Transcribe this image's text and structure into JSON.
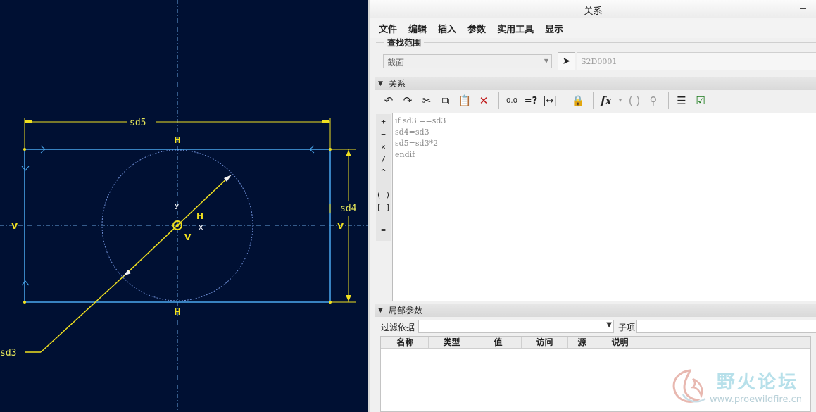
{
  "sketch": {
    "dimensions": [
      "sd5",
      "sd4",
      "sd3"
    ],
    "constraints": {
      "horizontal": "H",
      "vertical": "V"
    },
    "axis_labels": {
      "x": "x",
      "y": "y"
    }
  },
  "dialog": {
    "title": "关系",
    "menu": [
      "文件",
      "编辑",
      "插入",
      "参数",
      "实用工具",
      "显示"
    ],
    "find_scope": {
      "legend": "查找范围",
      "section_value": "截面",
      "selected_item": "S2D0001"
    },
    "relations_header": "关系",
    "toolbar_icons": [
      "undo-icon",
      "redo-icon",
      "cut-icon",
      "copy-icon",
      "paste-icon",
      "delete-icon",
      "evaluate-icon",
      "verify-icon",
      "sort-icon",
      "lock-icon",
      "function-icon",
      "bracket-icon",
      "search-icon",
      "params-icon",
      "check-icon"
    ],
    "operators": [
      "+",
      "−",
      "×",
      "/",
      "^",
      "( )",
      "[ ]",
      "="
    ],
    "relations": [
      "if sd3 ==sd3",
      "sd4=sd3",
      "sd5=sd3*2",
      "endif"
    ],
    "local_params_header": "局部参数",
    "filter_label": "过滤依据",
    "sub_label": "子项",
    "columns": [
      "名称",
      "类型",
      "值",
      "访问",
      "源",
      "说明"
    ]
  },
  "watermark": {
    "title": "野火论坛",
    "url": "www.proewildfire.cn"
  }
}
